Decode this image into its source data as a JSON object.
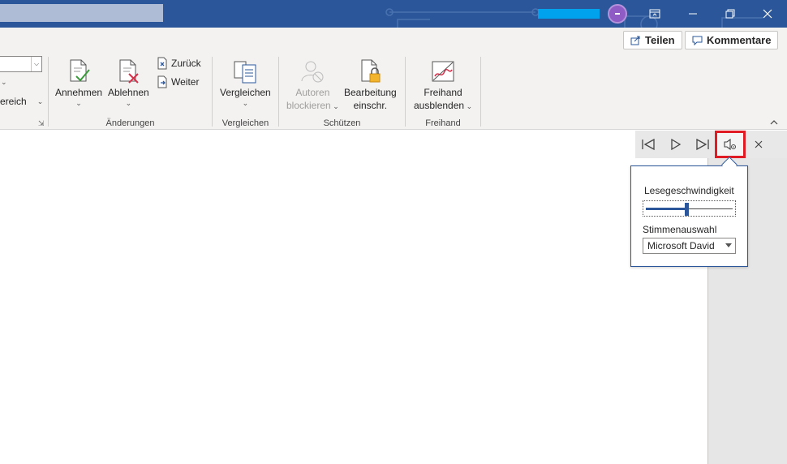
{
  "titlebar": {
    "colors": {
      "bg": "#2b579a",
      "account": "#00a2ed",
      "avatar": "#8e5cc4"
    },
    "icons": {
      "ribbon_display": "ribbon-display-icon",
      "minimize": "minimize-icon",
      "restore": "restore-icon",
      "close": "close-icon"
    }
  },
  "ribbon": {
    "share_label": "Teilen",
    "comments_label": "Kommentare",
    "partial_label": "ereich",
    "groups": {
      "changes": {
        "label": "Änderungen",
        "accept": "Annehmen",
        "reject": "Ablehnen",
        "previous": "Zurück",
        "next": "Weiter"
      },
      "compare": {
        "label": "Vergleichen",
        "compare": "Vergleichen"
      },
      "protect": {
        "label": "Schützen",
        "block_authors_1": "Autoren",
        "block_authors_2": "blockieren",
        "restrict_1": "Bearbeitung",
        "restrict_2": "einschr."
      },
      "ink": {
        "label": "Freihand",
        "hide_ink_1": "Freihand",
        "hide_ink_2": "ausblenden"
      }
    }
  },
  "read_aloud": {
    "icons": [
      "previous-paragraph-icon",
      "play-icon",
      "next-paragraph-icon",
      "speaker-settings-icon",
      "close-icon"
    ],
    "settings": {
      "speed_label": "Lesegeschwindigkeit",
      "speed_value": 0.47,
      "voice_label": "Stimmenauswahl",
      "voice_value": "Microsoft David"
    }
  }
}
